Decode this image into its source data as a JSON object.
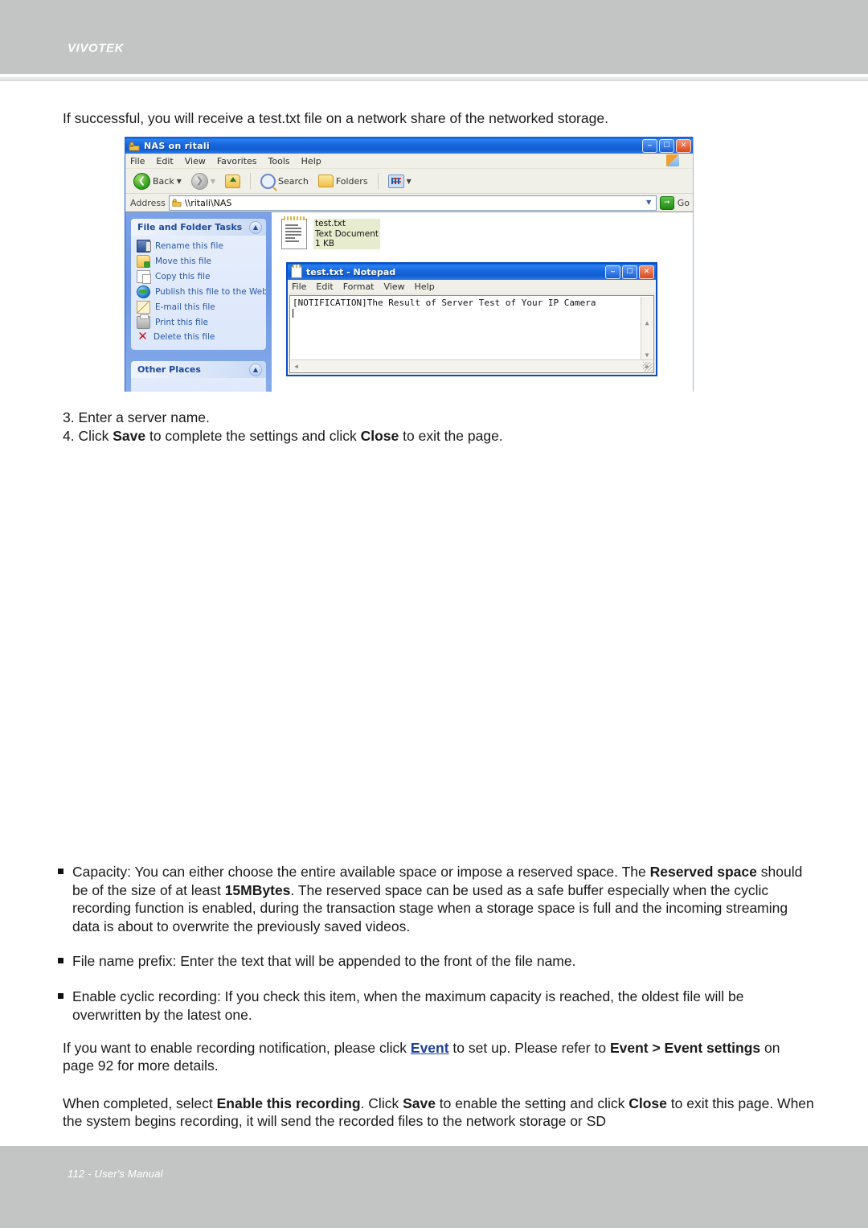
{
  "header": {
    "brand": "VIVOTEK"
  },
  "footer": {
    "text": "112 - User's Manual"
  },
  "intro": {
    "line": "If successful, you will receive a test.txt file on a network share of the networked storage."
  },
  "steps": {
    "item3": "3. Enter a server name.",
    "item4_pre": "4. Click ",
    "item4_b1": "Save",
    "item4_mid": " to complete the settings and click ",
    "item4_b2": "Close",
    "item4_post": " to exit the page."
  },
  "screenshot": {
    "explorer": {
      "title": "NAS on ritali",
      "title_icon": "shared-folder-icon",
      "window_buttons": [
        "minimize",
        "maximize",
        "close"
      ],
      "menu": [
        "File",
        "Edit",
        "View",
        "Favorites",
        "Tools",
        "Help"
      ],
      "toolbar": {
        "back_label": "Back",
        "search_label": "Search",
        "folders_label": "Folders"
      },
      "address": {
        "label": "Address",
        "value": "\\\\ritali\\NAS",
        "go_label": "Go"
      },
      "tasks_panel": {
        "title": "File and Folder Tasks",
        "items": [
          {
            "label": "Rename this file",
            "icon": "rename-icon"
          },
          {
            "label": "Move this file",
            "icon": "move-icon"
          },
          {
            "label": "Copy this file",
            "icon": "copy-icon"
          },
          {
            "label": "Publish this file to the Web",
            "icon": "globe-icon"
          },
          {
            "label": "E-mail this file",
            "icon": "mail-icon"
          },
          {
            "label": "Print this file",
            "icon": "printer-icon"
          },
          {
            "label": "Delete this file",
            "icon": "delete-x-icon"
          }
        ]
      },
      "other_places_panel": {
        "title": "Other Places"
      },
      "file": {
        "name": "test.txt",
        "type": "Text Document",
        "size": "1 KB"
      }
    },
    "notepad": {
      "title": "test.txt - Notepad",
      "menu": [
        "File",
        "Edit",
        "Format",
        "View",
        "Help"
      ],
      "content": "[NOTIFICATION]The Result of Server Test of Your IP Camera"
    }
  },
  "notes": {
    "capacity": {
      "p1": "Capacity: You can either choose the entire available space or impose a reserved space. The ",
      "b1": "Reserved space",
      "p2": " should be of the size of at least ",
      "b2": "15MBytes",
      "p3": ". The reserved space can be used as a safe buffer especially when the cyclic recording function is enabled, during the transaction stage when a storage space is full and the incoming streaming data is about to overwrite the previously saved videos."
    },
    "file_prefix": "File name prefix: Enter the text that will be appended to the front of the file name.",
    "cyclic": "Enable cyclic recording: If you check this item, when the maximum capacity is reached, the oldest file will be overwritten by the latest one.",
    "event_note": {
      "p1": "If you want to enable recording notification, please click ",
      "link": "Event",
      "p2": " to set up. Please refer to ",
      "b1": "Event > Event settings",
      "p3": " on page 92 for more details."
    },
    "completed_note": {
      "p1": "When completed, select ",
      "b1": "Enable this recording",
      "p2": ". Click ",
      "b2": "Save",
      "p3": " to enable the setting and click ",
      "b3": "Close",
      "p4": " to exit this page. When the system begins recording, it will send the recorded files to the network storage or SD"
    }
  }
}
